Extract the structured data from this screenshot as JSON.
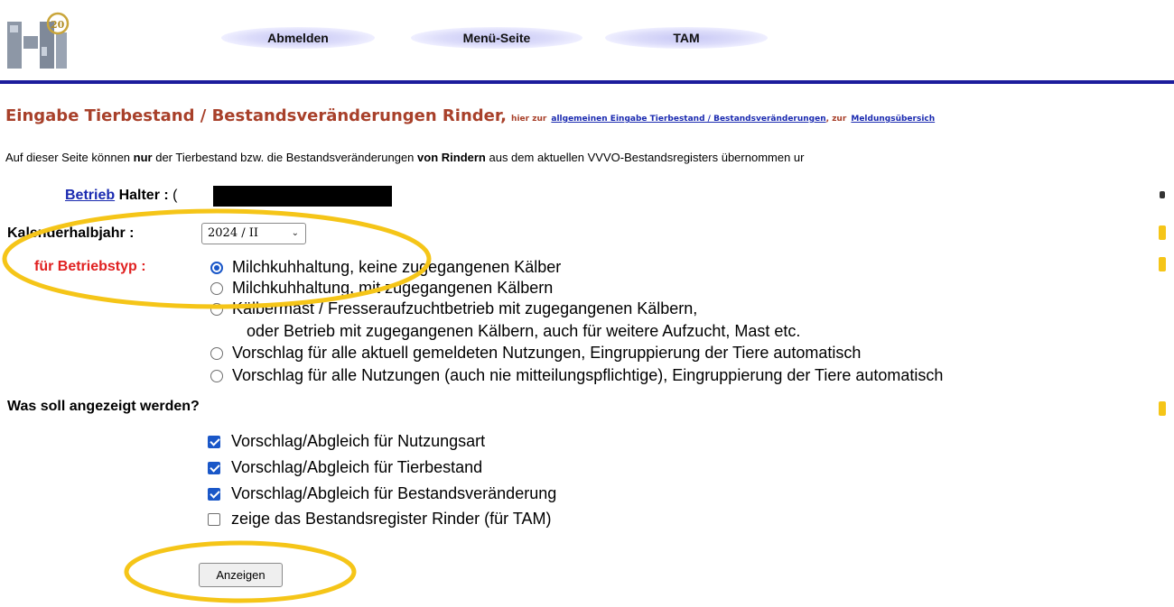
{
  "header": {
    "logo_label": "HI",
    "logo_badge": "20",
    "nav": [
      "Abmelden",
      "Menü-Seite",
      "TAM"
    ]
  },
  "title": {
    "main": "Eingabe Tierbestand / Bestandsveränderungen Rinder,",
    "hier_zur": "hier zur",
    "link1": "allgemeinen Eingabe Tierbestand / Bestandsveränderungen",
    "zur": ", zur",
    "link2": "Meldungsübersich"
  },
  "info": {
    "part1": "Auf dieser Seite können ",
    "bold1": "nur",
    "part2": " der Tierbestand bzw. die Bestandsveränderungen ",
    "bold2": "von Rindern",
    "part3": " aus dem aktuellen VVVO-Bestandsregisters übernommen ur"
  },
  "form": {
    "betrieb_link": "Betrieb",
    "halter_label": "Halter :",
    "halter_value": "(",
    "kalender_label": "Kalenderhalbjahr :",
    "kalender_value": "2024 / II",
    "betriebstyp_label": "für Betriebstyp :",
    "betriebstyp_options": [
      {
        "line1": "Milchkuhhaltung, keine zugegangenen Kälber",
        "selected": true
      },
      {
        "line1": "Milchkuhhaltung, mit zugegangenen Kälbern",
        "selected": false
      },
      {
        "line1": "Kälbermast / Fresseraufzuchtbetrieb mit zugegangenen Kälbern,",
        "line2": "oder Betrieb mit zugegangenen Kälbern, auch für weitere Aufzucht, Mast etc.",
        "selected": false
      },
      {
        "line1": "Vorschlag für alle aktuell gemeldeten Nutzungen, Eingruppierung der Tiere automatisch",
        "selected": false
      },
      {
        "line1": "Vorschlag für alle Nutzungen (auch nie mitteilungspflichtige), Eingruppierung der Tiere automatisch",
        "selected": false
      }
    ],
    "anzeige_label": "Was soll angezeigt werden?",
    "anzeige_options": [
      {
        "label": "Vorschlag/Abgleich für Nutzungsart",
        "checked": true
      },
      {
        "label": "Vorschlag/Abgleich für Tierbestand",
        "checked": true
      },
      {
        "label": "Vorschlag/Abgleich für Bestandsveränderung",
        "checked": true
      },
      {
        "label": "zeige das Bestandsregister Rinder (für TAM)",
        "checked": false
      }
    ],
    "submit_label": "Anzeigen"
  },
  "colors": {
    "accent_blue": "#1c1c9c",
    "title_brown": "#a8402a",
    "label_red": "#e02020",
    "link_blue": "#1a2ab0",
    "annotation_yellow": "#f5c518"
  }
}
